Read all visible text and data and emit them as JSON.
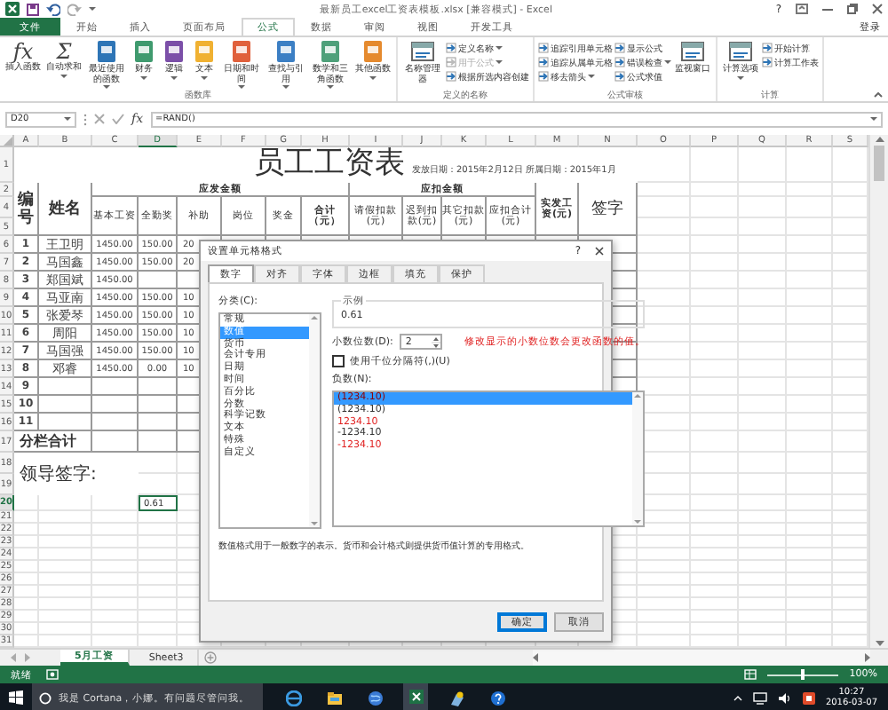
{
  "window": {
    "title": "最新员工excel工资表模板.xlsx [兼容模式] - Excel",
    "help": "?"
  },
  "ribbon_tabs": [
    {
      "label": "文件",
      "kind": "file",
      "selected": false
    },
    {
      "label": "开始",
      "kind": "tab",
      "selected": false
    },
    {
      "label": "插入",
      "kind": "tab",
      "selected": false
    },
    {
      "label": "页面布局",
      "kind": "tab",
      "selected": false
    },
    {
      "label": "公式",
      "kind": "tab",
      "selected": true
    },
    {
      "label": "数据",
      "kind": "tab",
      "selected": false
    },
    {
      "label": "审阅",
      "kind": "tab",
      "selected": false
    },
    {
      "label": "视图",
      "kind": "tab",
      "selected": false
    },
    {
      "label": "开发工具",
      "kind": "tab",
      "selected": false
    }
  ],
  "account": "登录",
  "ribbon_groups": [
    {
      "label": "函数库",
      "commands": [
        {
          "label": "插入函数",
          "kind": "glyph",
          "glyph": "fx",
          "dropdown": false,
          "disabled": false
        },
        {
          "label": "自动求和",
          "kind": "glyph",
          "glyph": "Σ",
          "dropdown": true,
          "disabled": false
        },
        {
          "label": "最近使用的函数",
          "kind": "tile",
          "color": "#2e75b6",
          "dropdown": true,
          "disabled": false
        },
        {
          "label": "财务",
          "kind": "tile",
          "color": "#3f9a6e",
          "dropdown": true,
          "disabled": false
        },
        {
          "label": "逻辑",
          "kind": "tile",
          "color": "#7b4fa8",
          "dropdown": true,
          "disabled": false
        },
        {
          "label": "文本",
          "kind": "tile",
          "color": "#f0b132",
          "dropdown": true,
          "disabled": false
        },
        {
          "label": "日期和时间",
          "kind": "tile",
          "color": "#e0603c",
          "dropdown": true,
          "disabled": false
        },
        {
          "label": "查找与引用",
          "kind": "tile",
          "color": "#3c7fc4",
          "dropdown": true,
          "disabled": false
        },
        {
          "label": "数学和三角函数",
          "kind": "tile",
          "color": "#4ea07a",
          "dropdown": true,
          "disabled": false
        },
        {
          "label": "其他函数",
          "kind": "tile",
          "color": "#e58a2e",
          "dropdown": true,
          "disabled": false
        }
      ]
    },
    {
      "label": "定义的名称",
      "commands": [
        {
          "label": "名称管理器",
          "kind": "large",
          "dropdown": false,
          "disabled": false
        },
        {
          "label": "定义名称",
          "kind": "small",
          "dropdown": true,
          "disabled": false
        },
        {
          "label": "用于公式",
          "kind": "small",
          "dropdown": true,
          "disabled": true
        },
        {
          "label": "根据所选内容创建",
          "kind": "small",
          "dropdown": false,
          "disabled": false
        }
      ]
    },
    {
      "label": "公式审核",
      "commands": [
        {
          "label": "追踪引用单元格",
          "kind": "small",
          "dropdown": false,
          "disabled": false
        },
        {
          "label": "追踪从属单元格",
          "kind": "small",
          "dropdown": false,
          "disabled": false
        },
        {
          "label": "移去箭头",
          "kind": "small",
          "dropdown": true,
          "disabled": false
        },
        {
          "label": "显示公式",
          "kind": "small",
          "dropdown": false,
          "disabled": false
        },
        {
          "label": "错误检查",
          "kind": "small",
          "dropdown": true,
          "disabled": false
        },
        {
          "label": "公式求值",
          "kind": "small",
          "dropdown": false,
          "disabled": false
        },
        {
          "label": "监视窗口",
          "kind": "large",
          "dropdown": false,
          "disabled": false
        }
      ]
    },
    {
      "label": "计算",
      "commands": [
        {
          "label": "计算选项",
          "kind": "large",
          "dropdown": true,
          "disabled": false
        },
        {
          "label": "开始计算",
          "kind": "small",
          "dropdown": false,
          "disabled": false
        },
        {
          "label": "计算工作表",
          "kind": "small",
          "dropdown": false,
          "disabled": false
        }
      ]
    }
  ],
  "formula_bar": {
    "name_box": "D20",
    "function_glyph": "fx",
    "formula": "=RAND()"
  },
  "columns": [
    {
      "label": "A",
      "selected": false
    },
    {
      "label": "B",
      "selected": false
    },
    {
      "label": "C",
      "selected": false
    },
    {
      "label": "D",
      "selected": true
    },
    {
      "label": "E",
      "selected": false
    },
    {
      "label": "F",
      "selected": false
    },
    {
      "label": "G",
      "selected": false
    },
    {
      "label": "H",
      "selected": false
    },
    {
      "label": "I",
      "selected": false
    },
    {
      "label": "J",
      "selected": false
    },
    {
      "label": "K",
      "selected": false
    },
    {
      "label": "L",
      "selected": false
    },
    {
      "label": "M",
      "selected": false
    },
    {
      "label": "N",
      "selected": false
    },
    {
      "label": "O",
      "selected": false
    },
    {
      "label": "P",
      "selected": false
    },
    {
      "label": "Q",
      "selected": false
    },
    {
      "label": "R",
      "selected": false
    },
    {
      "label": "S",
      "selected": false
    }
  ],
  "row_numbers": [
    {
      "label": "1",
      "selected": false
    },
    {
      "label": "2",
      "selected": false
    },
    {
      "label": "4",
      "selected": false
    },
    {
      "label": "5",
      "selected": false
    },
    {
      "label": "6",
      "selected": false
    },
    {
      "label": "7",
      "selected": false
    },
    {
      "label": "8",
      "selected": false
    },
    {
      "label": "9",
      "selected": false
    },
    {
      "label": "10",
      "selected": false
    },
    {
      "label": "11",
      "selected": false
    },
    {
      "label": "12",
      "selected": false
    },
    {
      "label": "13",
      "selected": false
    },
    {
      "label": "14",
      "selected": false
    },
    {
      "label": "15",
      "selected": false
    },
    {
      "label": "16",
      "selected": false
    },
    {
      "label": "17",
      "selected": false
    },
    {
      "label": "18",
      "selected": false
    },
    {
      "label": "19",
      "selected": false
    },
    {
      "label": "20",
      "selected": true
    },
    {
      "label": "21",
      "selected": false
    },
    {
      "label": "22",
      "selected": false
    },
    {
      "label": "23",
      "selected": false
    },
    {
      "label": "24",
      "selected": false
    },
    {
      "label": "25",
      "selected": false
    },
    {
      "label": "26",
      "selected": false
    },
    {
      "label": "27",
      "selected": false
    },
    {
      "label": "28",
      "selected": false
    },
    {
      "label": "29",
      "selected": false
    },
    {
      "label": "30",
      "selected": false
    },
    {
      "label": "31",
      "selected": false
    }
  ],
  "sheet": {
    "title": "员工工资表",
    "dates": "发放日期：2015年2月12日 所属日期：2015年1月",
    "header": {
      "number": "编号",
      "name": "姓名",
      "gross": "应发金额",
      "gross_items": [
        "基本工资",
        "全勤奖",
        "补助",
        "岗位",
        "奖金",
        "合计（元）"
      ],
      "deductions": "应扣金额",
      "deduction_items": [
        "请假扣款(元)",
        "迟到扣款(元)",
        "其它扣款(元)",
        "应扣合计(元)"
      ],
      "net": "实发工资(元)",
      "signature": "签字"
    },
    "rows": [
      {
        "number": "1",
        "name": "王卫明",
        "base": "1450.00",
        "attendance": "150.00",
        "allowance": "20"
      },
      {
        "number": "2",
        "name": "马国鑫",
        "base": "1450.00",
        "attendance": "150.00",
        "allowance": "20"
      },
      {
        "number": "3",
        "name": "郑国斌",
        "base": "1450.00"
      },
      {
        "number": "4",
        "name": "马亚南",
        "base": "1450.00",
        "attendance": "150.00",
        "allowance": "10"
      },
      {
        "number": "5",
        "name": "张爱琴",
        "base": "1450.00",
        "attendance": "150.00",
        "allowance": "10"
      },
      {
        "number": "6",
        "name": "周阳",
        "base": "1450.00",
        "attendance": "150.00",
        "allowance": "10"
      },
      {
        "number": "7",
        "name": "马国强",
        "base": "1450.00",
        "attendance": "150.00",
        "allowance": "10"
      },
      {
        "number": "8",
        "name": "邓睿",
        "base": "1450.00",
        "attendance": "0.00",
        "allowance": "10"
      },
      {
        "number": "9"
      },
      {
        "number": "10"
      },
      {
        "number": "11"
      }
    ],
    "subtotal": "分栏合计",
    "approval": "领导签字:",
    "active_cell": "0.61"
  },
  "dialog": {
    "title": "设置单元格格式",
    "help": "?",
    "tabs": [
      {
        "label": "数字",
        "selected": true
      },
      {
        "label": "对齐",
        "selected": false
      },
      {
        "label": "字体",
        "selected": false
      },
      {
        "label": "边框",
        "selected": false
      },
      {
        "label": "填充",
        "selected": false
      },
      {
        "label": "保护",
        "selected": false
      }
    ],
    "category_label": "分类(C):",
    "categories": [
      {
        "label": "常规",
        "selected": false
      },
      {
        "label": "数值",
        "selected": true
      },
      {
        "label": "货币",
        "selected": false
      },
      {
        "label": "会计专用",
        "selected": false
      },
      {
        "label": "日期",
        "selected": false
      },
      {
        "label": "时间",
        "selected": false
      },
      {
        "label": "百分比",
        "selected": false
      },
      {
        "label": "分数",
        "selected": false
      },
      {
        "label": "科学记数",
        "selected": false
      },
      {
        "label": "文本",
        "selected": false
      },
      {
        "label": "特殊",
        "selected": false
      },
      {
        "label": "自定义",
        "selected": false
      }
    ],
    "sample_label": "示例",
    "sample": "0.61",
    "decimals_label": "小数位数(D):",
    "decimals": "2",
    "note": "修改显示的小数位数会更改函数的值。",
    "separator": {
      "label": "使用千位分隔符(,)(U)",
      "checked": false
    },
    "negative_label": "负数(N):",
    "negatives": [
      {
        "label": "(1234.10)",
        "red": true,
        "selected": true
      },
      {
        "label": "(1234.10)",
        "red": false,
        "selected": false
      },
      {
        "label": "1234.10",
        "red": true,
        "selected": false
      },
      {
        "label": "-1234.10",
        "red": false,
        "selected": false
      },
      {
        "label": "-1234.10",
        "red": true,
        "selected": false
      }
    ],
    "description": "数值格式用于一般数字的表示。货币和会计格式则提供货币值计算的专用格式。",
    "buttons": [
      {
        "label": "确定",
        "default": true
      },
      {
        "label": "取消",
        "default": false
      }
    ]
  },
  "sheet_tabs": [
    {
      "label": "5月工资",
      "selected": true
    },
    {
      "label": "Sheet3",
      "selected": false
    }
  ],
  "status_bar": {
    "status": "就绪",
    "zoom": "100%",
    "level": 0.5
  },
  "taskbar": {
    "search": "我是 Cortana，小娜。有问题尽管问我。",
    "time": "10:27",
    "date": "2016-03-07"
  }
}
